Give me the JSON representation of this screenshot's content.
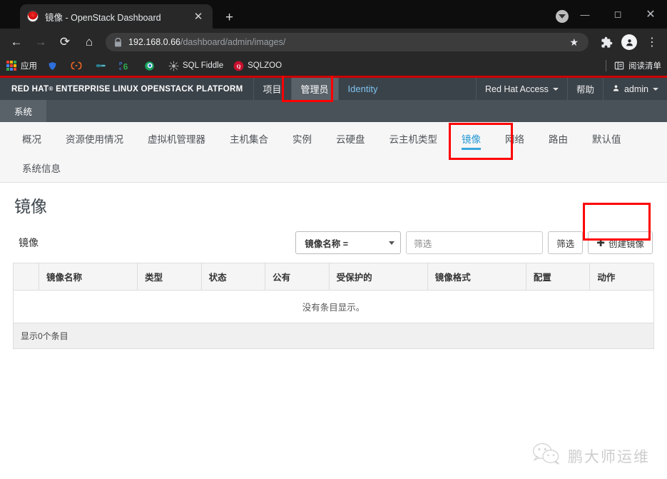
{
  "browser": {
    "tab": {
      "title": "镜像 - OpenStack Dashboard",
      "favicon": "redhat-favicon",
      "close_label": "✕"
    },
    "new_tab_label": "+",
    "window_controls": {
      "minimize": "—",
      "maximize": "◻",
      "close": "✕"
    },
    "nav": {
      "back": "←",
      "forward": "→",
      "reload": "⟳",
      "home": "⌂"
    },
    "omnibox": {
      "lock_icon": "lock-icon",
      "url_host": "192.168.0.66",
      "url_path": "/dashboard/admin/images/",
      "star_icon": "★"
    },
    "toolbar_icons": {
      "extensions": "puzzle-icon",
      "profile": "avatar-icon",
      "menu": "⋮"
    },
    "bookmarks": [
      {
        "label": "应用",
        "icon": "apps-grid-icon"
      },
      {
        "label": "",
        "icon": "blue-shield-icon"
      },
      {
        "label": "",
        "icon": "orange-brackets-icon"
      },
      {
        "label": "",
        "icon": "teal-link-icon"
      },
      {
        "label": "",
        "icon": "p6-icon"
      },
      {
        "label": "",
        "icon": "green-eye-icon"
      },
      {
        "label": "SQL Fiddle",
        "icon": "gray-burst-icon"
      },
      {
        "label": "SQLZOO",
        "icon": "red-circle-icon"
      }
    ],
    "reading_list": {
      "label": "阅读清单",
      "icon": "reading-list-icon"
    }
  },
  "header": {
    "brand_redhat": "RED HAT",
    "brand_sup": "®",
    "brand_rest": "ENTERPRISE LINUX OPENSTACK PLATFORM",
    "nav": [
      {
        "label": "项目",
        "active": false
      },
      {
        "label": "管理员",
        "active": true
      },
      {
        "label": "Identity",
        "active": false
      }
    ],
    "right": [
      {
        "label": "Red Hat Access",
        "caret": true
      },
      {
        "label": "帮助",
        "caret": false
      },
      {
        "label": "admin",
        "caret": true,
        "icon": "user-icon"
      }
    ],
    "breadcrumb": "系统"
  },
  "tabs": [
    {
      "label": "概况",
      "active": false
    },
    {
      "label": "资源使用情况",
      "active": false
    },
    {
      "label": "虚拟机管理器",
      "active": false
    },
    {
      "label": "主机集合",
      "active": false
    },
    {
      "label": "实例",
      "active": false
    },
    {
      "label": "云硬盘",
      "active": false
    },
    {
      "label": "云主机类型",
      "active": false
    },
    {
      "label": "镜像",
      "active": true
    },
    {
      "label": "网络",
      "active": false
    },
    {
      "label": "路由",
      "active": false
    },
    {
      "label": "默认值",
      "active": false
    },
    {
      "label": "系统信息",
      "active": false
    }
  ],
  "page": {
    "title": "镜像",
    "panel_title": "镜像",
    "filter_select_value": "镜像名称 =",
    "filter_input_placeholder": "筛选",
    "filter_button_label": "筛选",
    "create_button_label": "创建镜像",
    "create_button_icon": "plus-icon"
  },
  "table": {
    "columns": [
      "",
      "镜像名称",
      "类型",
      "状态",
      "公有",
      "受保护的",
      "镜像格式",
      "配置",
      "动作"
    ],
    "rows": [],
    "empty_message": "没有条目显示。",
    "footer": "显示0个条目"
  },
  "watermark": {
    "text": "鹏大师运维",
    "icon": "wechat-icon"
  },
  "annotations": {
    "highlight_color": "#ff0000",
    "boxes": [
      {
        "name": "admin-nav-highlight"
      },
      {
        "name": "images-tab-highlight"
      },
      {
        "name": "create-image-highlight"
      }
    ]
  }
}
